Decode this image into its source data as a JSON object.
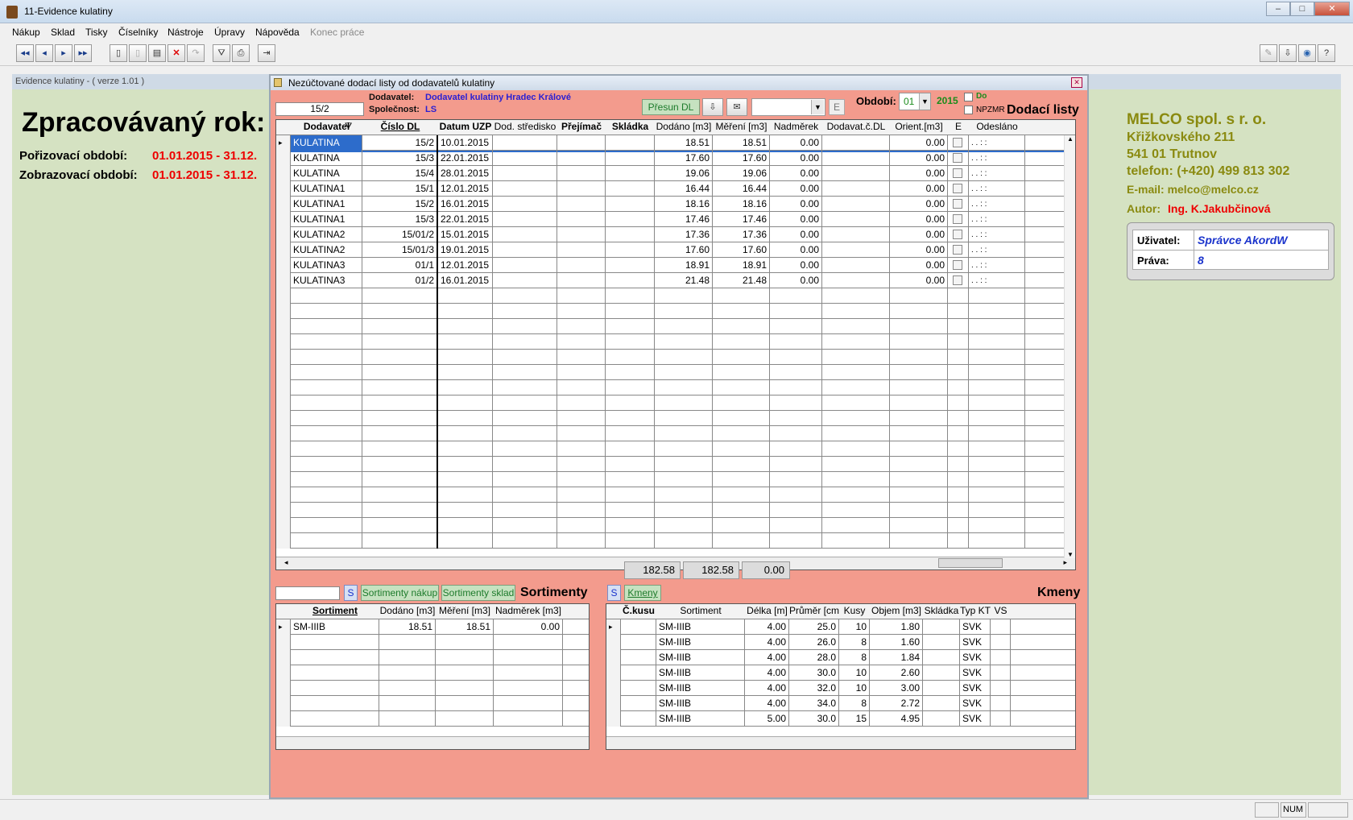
{
  "app": {
    "title": "11-Evidence kulatiny"
  },
  "menu": [
    "Nákup",
    "Sklad",
    "Tisky",
    "Číselníky",
    "Nástroje",
    "Úpravy",
    "Nápověda",
    "Konec práce"
  ],
  "evidence_header": "Evidence kulatiny   -    ( verze 1.01 )",
  "left": {
    "title": "Zpracovávaný rok:",
    "por_label": "Pořizovací období:",
    "por_value": "01.01.2015 - 31.12.",
    "zob_label": "Zobrazovací období:",
    "zob_value": "01.01.2015 - 31.12."
  },
  "company": {
    "name": "MELCO spol. s r. o.",
    "street": "Křižkovského 211",
    "city": "541 01 Trutnov",
    "phone": "telefon: (+420) 499 813 302",
    "email": "E-mail: melco@melco.cz",
    "author_label": "Autor:",
    "author": "Ing. K.Jakubčinová",
    "user_label": "Uživatel:",
    "user": "Správce AkordW",
    "rights_label": "Práva:",
    "rights": "8"
  },
  "dialog": {
    "title": "Nezúčtované dodací listy od dodavatelů kulatiny",
    "search_value": "15/2",
    "supplier_label": "Dodavatel:",
    "supplier": "Dodavatel kulatiny Hradec Králové",
    "company_label": "Společnost:",
    "company": "LS",
    "move_button": "Přesun DL",
    "e_button": "E",
    "period_label": "Období:",
    "period_month": "01",
    "period_year": "2015",
    "do_label": "Do",
    "npzmr_label": "NPZMR",
    "section_title": "Dodací listy",
    "columns": [
      "Dodavatel",
      "Číslo DL",
      "Datum UZP",
      "Dod. středisko",
      "Přejímač",
      "Skládka",
      "Dodáno [m3]",
      "Měření [m3]",
      "Nadměrek",
      "Dodavat.č.DL",
      "Orient.[m3]",
      "E",
      "Odesláno"
    ],
    "rows": [
      [
        "KULATINA",
        "15/2",
        "10.01.2015",
        "18.51",
        "18.51",
        "0.00",
        "0.00"
      ],
      [
        "KULATINA",
        "15/3",
        "22.01.2015",
        "17.60",
        "17.60",
        "0.00",
        "0.00"
      ],
      [
        "KULATINA",
        "15/4",
        "28.01.2015",
        "19.06",
        "19.06",
        "0.00",
        "0.00"
      ],
      [
        "KULATINA1",
        "15/1",
        "12.01.2015",
        "16.44",
        "16.44",
        "0.00",
        "0.00"
      ],
      [
        "KULATINA1",
        "15/2",
        "16.01.2015",
        "18.16",
        "18.16",
        "0.00",
        "0.00"
      ],
      [
        "KULATINA1",
        "15/3",
        "22.01.2015",
        "17.46",
        "17.46",
        "0.00",
        "0.00"
      ],
      [
        "KULATINA2",
        "15/01/2",
        "15.01.2015",
        "17.36",
        "17.36",
        "0.00",
        "0.00"
      ],
      [
        "KULATINA2",
        "15/01/3",
        "19.01.2015",
        "17.60",
        "17.60",
        "0.00",
        "0.00"
      ],
      [
        "KULATINA3",
        "01/1",
        "12.01.2015",
        "18.91",
        "18.91",
        "0.00",
        "0.00"
      ],
      [
        "KULATINA3",
        "01/2",
        "16.01.2015",
        "21.48",
        "21.48",
        "0.00",
        "0.00"
      ]
    ],
    "odeslano_placeholder": " .  .      :  :",
    "totals": [
      "182.58",
      "182.58",
      "0.00"
    ],
    "sort": {
      "s_button": "S",
      "buy_button": "Sortimenty nákup",
      "stock_button": "Sortimenty sklad",
      "title": "Sortimenty",
      "columns": [
        "Sortiment",
        "Dodáno [m3]",
        "Měření [m3]",
        "Nadměrek [m3]"
      ],
      "rows": [
        [
          "SM-IIIB",
          "18.51",
          "18.51",
          "0.00"
        ]
      ]
    },
    "kmeny": {
      "s_button": "S",
      "kmeny_button": "Kmeny",
      "title": "Kmeny",
      "columns": [
        "Č.kusu",
        "Sortiment",
        "Délka [m]",
        "Průměr [cm]",
        "Kusy",
        "Objem [m3]",
        "Skládka",
        "Typ KT",
        "VS"
      ],
      "rows": [
        [
          "SM-IIIB",
          "4.00",
          "25.0",
          "10",
          "1.80",
          "SVK"
        ],
        [
          "SM-IIIB",
          "4.00",
          "26.0",
          "8",
          "1.60",
          "SVK"
        ],
        [
          "SM-IIIB",
          "4.00",
          "28.0",
          "8",
          "1.84",
          "SVK"
        ],
        [
          "SM-IIIB",
          "4.00",
          "30.0",
          "10",
          "2.60",
          "SVK"
        ],
        [
          "SM-IIIB",
          "4.00",
          "32.0",
          "10",
          "3.00",
          "SVK"
        ],
        [
          "SM-IIIB",
          "4.00",
          "34.0",
          "8",
          "2.72",
          "SVK"
        ],
        [
          "SM-IIIB",
          "5.00",
          "30.0",
          "15",
          "4.95",
          "SVK"
        ]
      ]
    }
  },
  "status": {
    "num": "NUM"
  }
}
